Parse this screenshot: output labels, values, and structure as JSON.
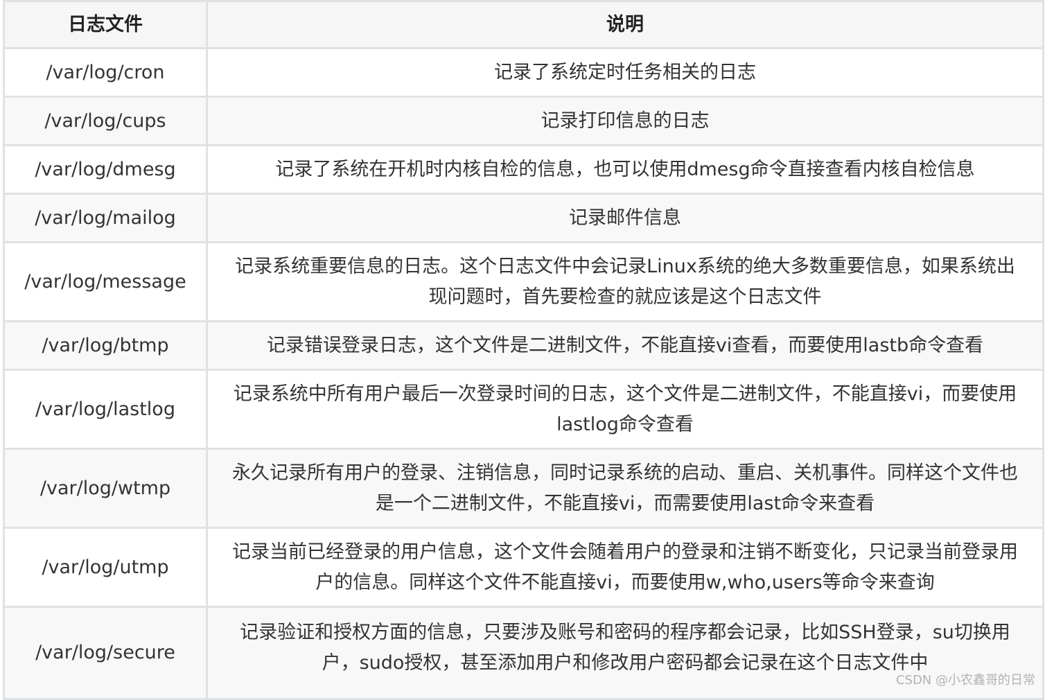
{
  "table": {
    "headers": [
      "日志文件",
      "说明"
    ],
    "rows": [
      {
        "file": "/var/log/cron",
        "desc": "记录了系统定时任务相关的日志"
      },
      {
        "file": "/var/log/cups",
        "desc": "记录打印信息的日志"
      },
      {
        "file": "/var/log/dmesg",
        "desc": "记录了系统在开机时内核自检的信息，也可以使用dmesg命令直接查看内核自检信息"
      },
      {
        "file": "/var/log/mailog",
        "desc": "记录邮件信息"
      },
      {
        "file": "/var/log/message",
        "desc": "记录系统重要信息的日志。这个日志文件中会记录Linux系统的绝大多数重要信息，如果系统出现问题时，首先要检查的就应该是这个日志文件"
      },
      {
        "file": "/var/log/btmp",
        "desc": "记录错误登录日志，这个文件是二进制文件，不能直接vi查看，而要使用lastb命令查看"
      },
      {
        "file": "/var/log/lastlog",
        "desc": "记录系统中所有用户最后一次登录时间的日志，这个文件是二进制文件，不能直接vi，而要使用lastlog命令查看"
      },
      {
        "file": "/var/log/wtmp",
        "desc": "永久记录所有用户的登录、注销信息，同时记录系统的启动、重启、关机事件。同样这个文件也是一个二进制文件，不能直接vi，而需要使用last命令来查看"
      },
      {
        "file": "/var/log/utmp",
        "desc": "记录当前已经登录的用户信息，这个文件会随着用户的登录和注销不断变化，只记录当前登录用户的信息。同样这个文件不能直接vi，而要使用w,who,users等命令来查询"
      },
      {
        "file": "/var/log/secure",
        "desc": "记录验证和授权方面的信息，只要涉及账号和密码的程序都会记录，比如SSH登录，su切换用户，sudo授权，甚至添加用户和修改用户密码都会记录在这个日志文件中"
      }
    ]
  },
  "watermark": "CSDN @小农鑫哥的日常"
}
